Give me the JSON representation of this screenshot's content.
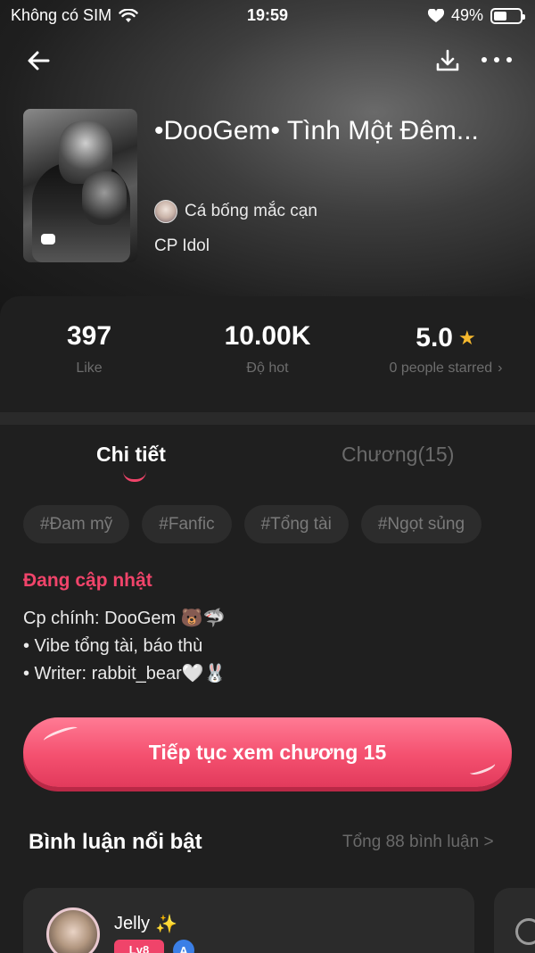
{
  "status_bar": {
    "carrier": "Không có SIM",
    "time": "19:59",
    "battery": "49%"
  },
  "book": {
    "title": "•DooGem• Tình Một Đêm...",
    "author": "Cá bống mắc cạn",
    "category": "CP Idol"
  },
  "stats": {
    "likes_value": "397",
    "likes_label": "Like",
    "hot_value": "10.00K",
    "hot_label": "Độ hot",
    "rating_value": "5.0",
    "rating_label": "0 people starred",
    "rating_chevron": "›"
  },
  "tabs": {
    "detail": "Chi tiết",
    "chapters": "Chương(15)"
  },
  "tags": [
    "#Đam mỹ",
    "#Fanfic",
    "#Tổng tài",
    "#Ngọt sủng"
  ],
  "update_status": "Đang cập nhật",
  "description": {
    "line1": "Cp chính: DooGem 🐻🦈",
    "line2": "• Vibe tổng tài, báo thù",
    "line3": "• Writer: rabbit_bear🤍🐰"
  },
  "cta_label": "Tiếp tục xem chương 15",
  "comments": {
    "title": "Bình luận nổi bật",
    "total_link": "Tổng 88 bình luận >",
    "first": {
      "name": "Jelly",
      "name_emoji": "✨",
      "level": "Lv8",
      "badge": "A"
    }
  },
  "colors": {
    "accent": "#f0446a",
    "background": "#141414",
    "card": "#1f1f1f",
    "star": "#f5b82e"
  }
}
